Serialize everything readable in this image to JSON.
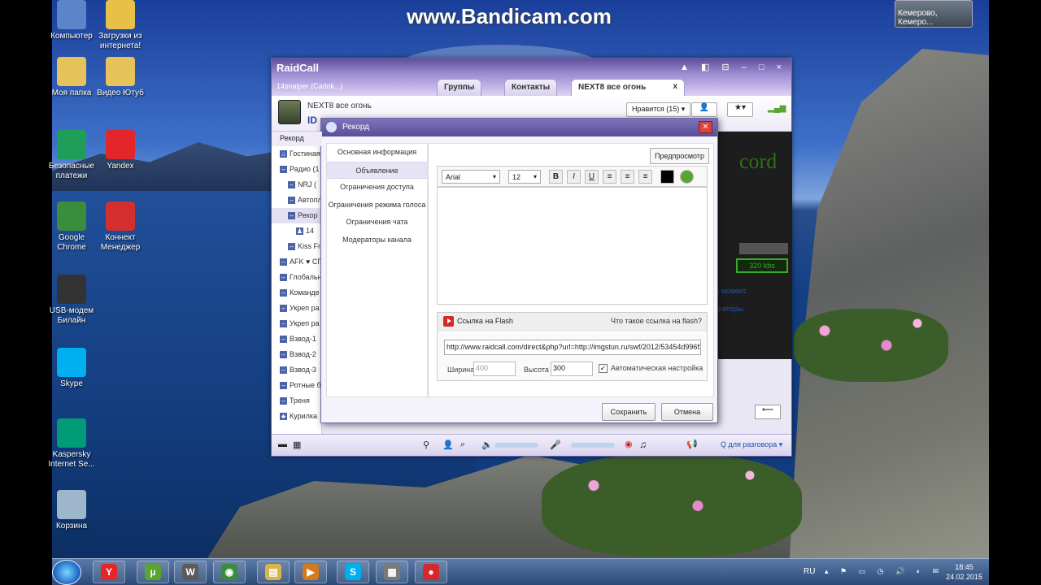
{
  "watermark": "www.Bandicam.com",
  "weather_label": "Кемерово, Кемеро...",
  "desktop_icons": [
    {
      "label": "Компьютер",
      "color": "#5a86c9"
    },
    {
      "label": "Загрузки из интернета!",
      "color": "#e9c046"
    },
    {
      "label": "Моя папка",
      "color": "#e6c25a"
    },
    {
      "label": "Видео Ютуб",
      "color": "#e6c25a"
    },
    {
      "label": "Безопасные платежи",
      "color": "#1f9e5a"
    },
    {
      "label": "Yandex",
      "color": "#e3262a"
    },
    {
      "label": "Google Chrome",
      "color": "#3a8d3c"
    },
    {
      "label": "Коннект Менеджер",
      "color": "#d32f2f"
    },
    {
      "label": "USB-модем Билайн",
      "color": "#333333"
    },
    {
      "label": "Skype",
      "color": "#00aff0"
    },
    {
      "label": "Kaspersky Internet Se...",
      "color": "#009b77"
    },
    {
      "label": "Корзина",
      "color": "#9db6cc"
    }
  ],
  "raidcall": {
    "app_name": "RaidCall",
    "user": "14snaiper (Cadok...)",
    "tabs": [
      "Группы",
      "Контакты",
      "NEXT8 все огонь"
    ],
    "tab_close": "x",
    "window_controls": "▲ ◧ ⊟ – □ ×",
    "channel_name": "NEXT8 все огонь",
    "channel_id": "ID",
    "like_label": "Нравится (15)",
    "sub_channel": "Рекорд",
    "tree": [
      {
        "mark": "⌂",
        "label": "Гостиная"
      },
      {
        "mark": "–",
        "label": "Радио (1"
      },
      {
        "mark": "–",
        "label": "NRJ ("
      },
      {
        "mark": "–",
        "label": "Автопл"
      },
      {
        "mark": "–",
        "label": "Рекор"
      },
      {
        "mark": "♟",
        "label": "14"
      },
      {
        "mark": "–",
        "label": "Kiss Fm"
      },
      {
        "mark": "–",
        "label": "AFK ♥ СП"
      },
      {
        "mark": "–",
        "label": "Глобальн"
      },
      {
        "mark": "–",
        "label": "Команде"
      },
      {
        "mark": "–",
        "label": "Укреп ра"
      },
      {
        "mark": "–",
        "label": "Укреп ра"
      },
      {
        "mark": "–",
        "label": "Взвод-1"
      },
      {
        "mark": "–",
        "label": "Взвод-2"
      },
      {
        "mark": "–",
        "label": "Взвод-3"
      },
      {
        "mark": "–",
        "label": "Ротные б"
      },
      {
        "mark": "–",
        "label": "Треня"
      },
      {
        "mark": "♣",
        "label": "Курилка"
      }
    ],
    "stream_logo": "cord",
    "stream_bitrate": "320 kbs",
    "side_text_1": "й момент.",
    "side_text_2": "траторы.",
    "bottom_mode": "Q для разговора"
  },
  "dialog": {
    "title": "Рекорд",
    "close": "✕",
    "nav": [
      "Основная информация",
      "Объявление",
      "Ограничения доступа",
      "Ограничения режима голоса",
      "Ограничения чата",
      "Модераторы канала"
    ],
    "active_nav": 1,
    "preview": "Предпросмотр",
    "font": "Arial",
    "size": "12",
    "fmt": [
      "B",
      "I",
      "U",
      "≡",
      "≡",
      "≡"
    ],
    "flash_title": "Ссылка на Flash",
    "flash_question": "Что такое ссылка на flash?",
    "flash_url": "http://www.raidcall.com/direct&php?url=http://imgstun.ru/swf/2012/53454d996f2",
    "width_label": "Ширина",
    "width_value": "400",
    "height_label": "Высота",
    "height_value": "300",
    "auto_label": "Автоматическая настройка",
    "auto_check": "✓",
    "save": "Сохранить",
    "cancel": "Отмена"
  },
  "taskbar": {
    "apps": [
      {
        "sym": "Y",
        "color": "#e3262a"
      },
      {
        "sym": "µ",
        "color": "#5aa532"
      },
      {
        "sym": "W",
        "color": "#5b5b5b"
      },
      {
        "sym": "◉",
        "color": "#3a8d3c"
      },
      {
        "sym": "▤",
        "color": "#d9b44a"
      },
      {
        "sym": "▶",
        "color": "#d37a1f"
      },
      {
        "sym": "S",
        "color": "#00aff0"
      },
      {
        "sym": "▦",
        "color": "#7a7a7a"
      },
      {
        "sym": "●",
        "color": "#d62828"
      }
    ],
    "lang": "RU",
    "time": "18:45",
    "date": "24.02.2015"
  }
}
